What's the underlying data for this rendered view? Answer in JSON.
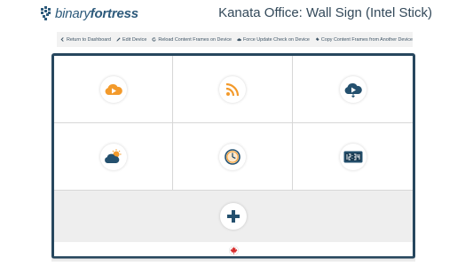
{
  "header": {
    "logo_text_light": "binary",
    "logo_text_bold": "fortress",
    "title": "Kanata Office: Wall Sign (Intel Stick)"
  },
  "toolbar": {
    "items": [
      {
        "label": "Return to Dashboard",
        "icon": "chevron-left-icon"
      },
      {
        "label": "Edit Device",
        "icon": "pencil-icon"
      },
      {
        "label": "Reload Content Frames on Device",
        "icon": "refresh-icon"
      },
      {
        "label": "Force Update Check on Device",
        "icon": "cloud-icon"
      },
      {
        "label": "Copy Content Frames from Another Device",
        "icon": "copy-icon"
      }
    ]
  },
  "tiles": [
    {
      "icon": "cloud-play-orange-icon",
      "color": "#f39a2b"
    },
    {
      "icon": "rss-icon",
      "color": "#f39a2b"
    },
    {
      "icon": "cloud-play-blue-icon",
      "color": "#24506e"
    },
    {
      "icon": "weather-sun-cloud-icon",
      "color": "#f39a2b"
    },
    {
      "icon": "clock-icon",
      "color": "#f39a2b"
    },
    {
      "icon": "digital-clock-icon",
      "color": "#24506e"
    }
  ],
  "add_icon": "plus-icon",
  "footer_icon": "maple-leaf-icon",
  "colors": {
    "navy": "#27475e",
    "orange": "#f39a2b",
    "red": "#d62d2d",
    "toolbar_bg": "#f2f2f2",
    "add_bg": "#eeeeee"
  }
}
